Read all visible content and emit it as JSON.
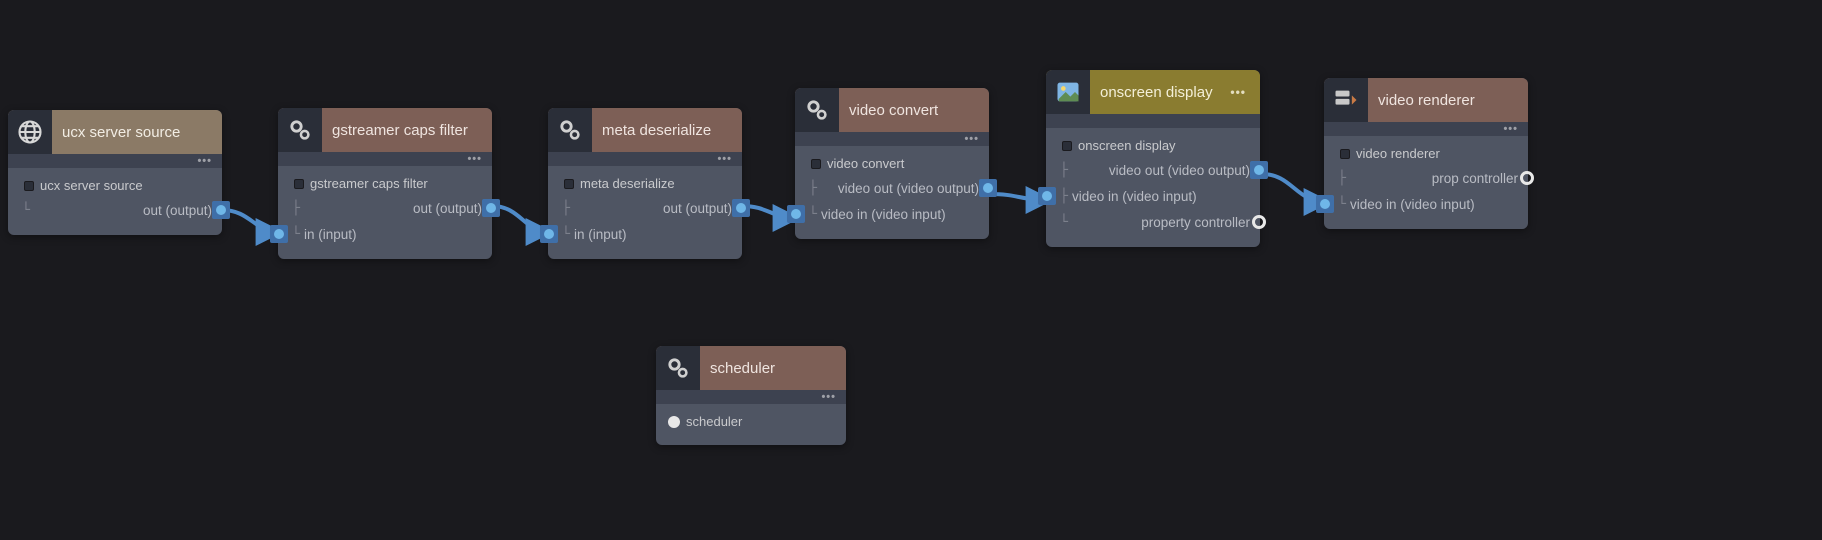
{
  "nodes": {
    "ucx": {
      "title": "ucx server source",
      "group": "ucx server source",
      "ports": {
        "out": "out (output)"
      }
    },
    "caps": {
      "title": "gstreamer caps filter",
      "group": "gstreamer caps filter",
      "ports": {
        "out": "out (output)",
        "in": "in (input)"
      }
    },
    "meta": {
      "title": "meta deserialize",
      "group": "meta deserialize",
      "ports": {
        "out": "out (output)",
        "in": "in (input)"
      }
    },
    "vconv": {
      "title": "video convert",
      "group": "video convert",
      "ports": {
        "vout": "video out (video output)",
        "vin": "video in (video input)"
      }
    },
    "osd": {
      "title": "onscreen display",
      "group": "onscreen display",
      "ports": {
        "vout": "video out (video output)",
        "vin": "video in (video input)",
        "pctrl": "property controller"
      }
    },
    "vrend": {
      "title": "video renderer",
      "group": "video renderer",
      "ports": {
        "pctrl": "prop controller",
        "vin": "video in (video input)"
      }
    },
    "sched": {
      "title": "scheduler",
      "group": "scheduler"
    }
  },
  "menu_glyph": "•••",
  "colors": {
    "canvas": "#1a1a1e",
    "node_body": "#4f5563",
    "header_tan": "#8b7a66",
    "header_brown": "#7d5f56",
    "header_olive": "#8a7c30",
    "wire": "#4f8bc9"
  }
}
